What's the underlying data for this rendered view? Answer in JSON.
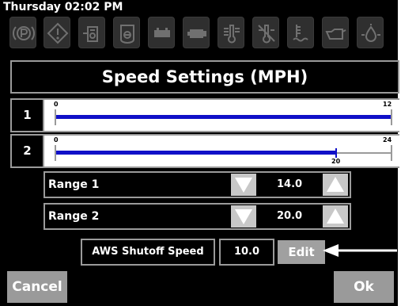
{
  "status_bar": {
    "datetime": "Thursday 02:02 PM"
  },
  "indicators": [
    "parking-brake-icon",
    "warning-icon",
    "fuel-water-icon",
    "filter-icon",
    "battery-icon",
    "engine-icon",
    "coolant-temp-icon",
    "no-coolant-icon",
    "hydraulic-temp-icon",
    "oil-level-icon",
    "oil-pressure-icon"
  ],
  "screen": {
    "title": "Speed Settings (MPH)"
  },
  "ranges": [
    {
      "row_label": "1",
      "min_label": "0",
      "max_label": "12",
      "value": 12,
      "max": 12,
      "value_label": ""
    },
    {
      "row_label": "2",
      "min_label": "0",
      "max_label": "24",
      "value": 20,
      "max": 24,
      "value_label": "20"
    }
  ],
  "controls": [
    {
      "label": "Range 1",
      "value": "14.0"
    },
    {
      "label": "Range 2",
      "value": "20.0"
    }
  ],
  "aws": {
    "label": "AWS Shutoff Speed",
    "value": "10.0",
    "edit_label": "Edit"
  },
  "footer": {
    "cancel_label": "Cancel",
    "ok_label": "Ok"
  },
  "colors": {
    "track_fill": "#1010c8",
    "button_gray": "#9a9a9a",
    "background": "#000000"
  }
}
